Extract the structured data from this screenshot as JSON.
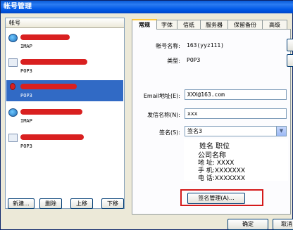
{
  "window": {
    "title": "帐号管理"
  },
  "accounts": {
    "header": "帐号",
    "items": [
      {
        "type": "IMAP",
        "icon": "globe-icon"
      },
      {
        "type": "POP3",
        "icon": "mailbox-icon"
      },
      {
        "type": "POP3",
        "icon": "red-account-icon"
      },
      {
        "type": "IMAP",
        "icon": "globe-icon"
      },
      {
        "type": "POP3",
        "icon": "mailbox-icon"
      }
    ],
    "buttons": {
      "new": "新建...",
      "delete": "删除",
      "up": "上移",
      "down": "下移"
    }
  },
  "tabs": [
    "常规",
    "字体",
    "信纸",
    "服务器",
    "保留备份",
    "高级"
  ],
  "general": {
    "account_name_label": "帐号名称:",
    "account_name_value": "163(yyz111)",
    "type_label": "类型:",
    "type_value": "POP3",
    "email_label": "Email地址(E):",
    "email_value": "XXX@163.com",
    "sender_label": "发信名称(N):",
    "sender_value": "xxx",
    "signature_label": "签名(S):",
    "signature_value": "签名3",
    "signature_manage_button": "签名管理(A)..."
  },
  "signature_preview": {
    "line1": "姓名  职位",
    "line2": "公司名称",
    "line3": "地  址: XXXX",
    "line4": "手  机:XXXXXXX",
    "line5": "电  话:XXXXXXX"
  },
  "footer": {
    "ok": "确定",
    "cancel": "取消"
  }
}
